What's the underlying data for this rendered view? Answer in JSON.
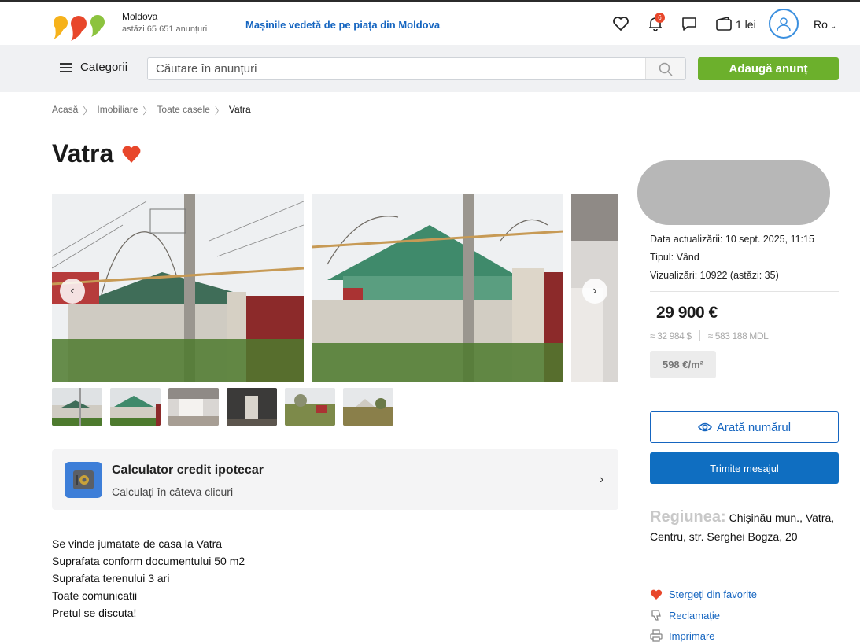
{
  "header": {
    "region": "Moldova",
    "ads_count": "astăzi 65 651 anunțuri",
    "promo": "Mașinile vedetă de pe piața din Moldova",
    "notifications_count": "6",
    "wallet": "1 lei",
    "language": "Ro"
  },
  "search": {
    "categories_label": "Categorii",
    "placeholder": "Căutare în anunțuri",
    "add_button": "Adaugă anunț"
  },
  "breadcrumb": [
    "Acasă",
    "Imobiliare",
    "Toate casele",
    "Vatra"
  ],
  "listing": {
    "title": "Vatra",
    "description": [
      "Se vinde jumatate de casa la Vatra",
      "Suprafata conform documentului 50 m2",
      "Suprafata terenului 3 ari",
      "Toate comunicatii",
      "Pretul se discuta!"
    ]
  },
  "calculator": {
    "title": "Calculator credit ipotecar",
    "subtitle": "Calculați în câteva clicuri"
  },
  "sidebar": {
    "updated": "Data actualizării: 10 sept. 2025, 11:15",
    "type": "Tipul: Vând",
    "views": "Vizualizări: 10922 (astăzi: 35)",
    "price": "29 900 €",
    "price_usd": "≈ 32 984 $",
    "price_mdl": "≈ 583 188 MDL",
    "price_per_m2": "598 €/m²",
    "show_number": "Arată numărul",
    "send_message": "Trimite mesajul",
    "region_label": "Regiunea:",
    "region_value": "Chișinău mun., Vatra, Centru, str. Serghei Bogza, 20",
    "actions": {
      "favorite": "Stergeți din favorite",
      "report": "Reclamație",
      "print": "Imprimare"
    }
  },
  "colors": {
    "accent_blue": "#1565c0",
    "add_green": "#6cb02c",
    "heart_red": "#e8472b"
  }
}
